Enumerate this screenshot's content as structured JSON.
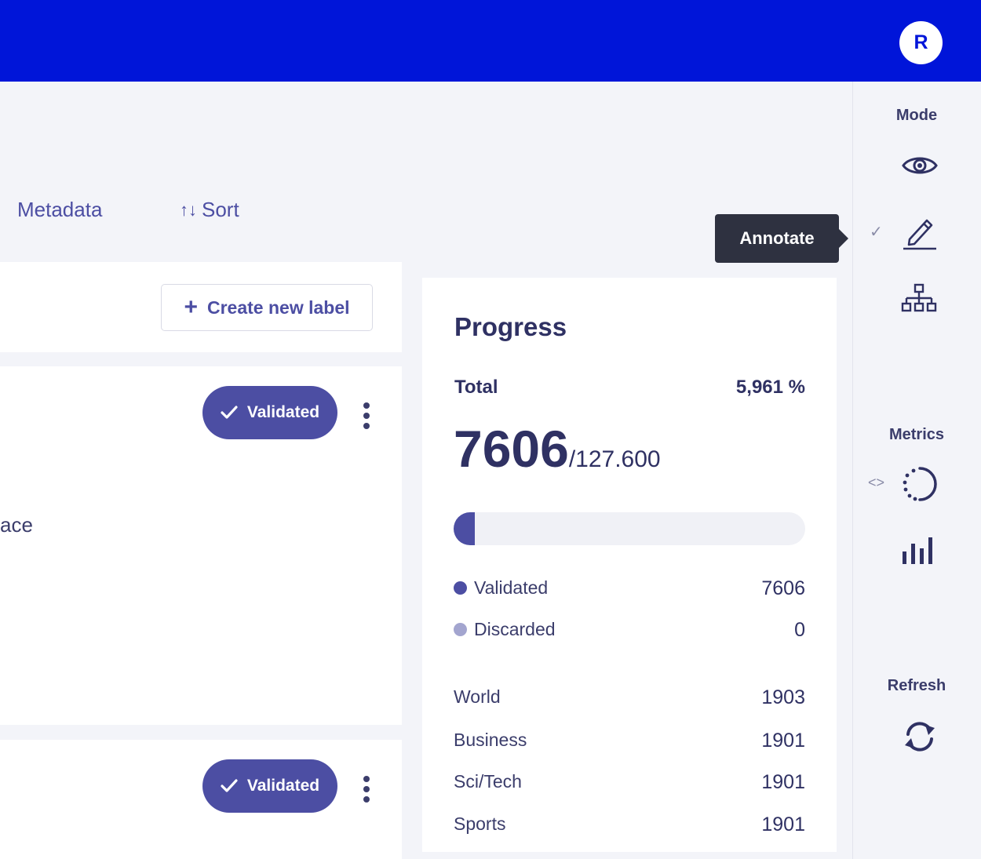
{
  "header": {
    "avatar_initial": "R",
    "brand_color": "#0015d9"
  },
  "toolbar": {
    "metadata_label": "Metadata",
    "sort_label": "Sort",
    "sort_icon": "sort-arrows-icon"
  },
  "labels_panel": {
    "create_label": "Create new label"
  },
  "records": [
    {
      "status": "Validated",
      "text_fragment": "ace"
    },
    {
      "status": "Validated"
    }
  ],
  "progress": {
    "title": "Progress",
    "total_label": "Total",
    "total_percent": "5,961 %",
    "validated_count": "7606",
    "total_records": "/127.600",
    "fill_fraction": 0.0596,
    "legend": [
      {
        "label": "Validated",
        "value": "7606",
        "color": "#4c4ea3"
      },
      {
        "label": "Discarded",
        "value": "0",
        "color": "#a3a5cf"
      }
    ],
    "categories": [
      {
        "label": "World",
        "value": "1903"
      },
      {
        "label": "Business",
        "value": "1901"
      },
      {
        "label": "Sci/Tech",
        "value": "1901"
      },
      {
        "label": "Sports",
        "value": "1901"
      }
    ]
  },
  "sidebar": {
    "mode_label": "Mode",
    "metrics_label": "Metrics",
    "refresh_label": "Refresh",
    "tooltip": "Annotate",
    "active_mode": "annotate"
  }
}
